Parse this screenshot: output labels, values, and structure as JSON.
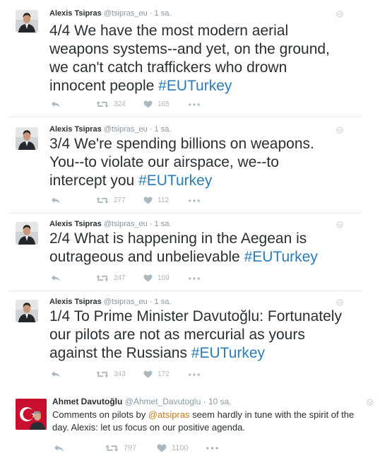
{
  "tweets": [
    {
      "name": "Alexis Tsipras",
      "handle": "@tsipras_eu",
      "time": "· 1 sa.",
      "text_main": "4/4 We have the most modern aerial weapons systems--and yet, on the ground, we can't catch traffickers who drown innocent people ",
      "hashtag": "#EUTurkey",
      "retweets": "324",
      "likes": "165"
    },
    {
      "name": "Alexis Tsipras",
      "handle": "@tsipras_eu",
      "time": "· 1 sa.",
      "text_main": "3/4 We're spending billions on weapons. You--to violate our airspace, we--to intercept you ",
      "hashtag": "#EUTurkey",
      "retweets": "277",
      "likes": "112"
    },
    {
      "name": "Alexis Tsipras",
      "handle": "@tsipras_eu",
      "time": "· 1 sa.",
      "text_main": "2/4 What is happening in the Aegean is outrageous and unbelievable ",
      "hashtag": "#EUTurkey",
      "retweets": "247",
      "likes": "109"
    },
    {
      "name": "Alexis Tsipras",
      "handle": "@tsipras_eu",
      "time": "· 1 sa.",
      "text_main": "1/4 To Prime Minister Davutoğlu: Fortunately our pilots are not as mercurial as yours against the Russians ",
      "hashtag": "#EUTurkey",
      "retweets": "343",
      "likes": "172"
    }
  ],
  "reply": {
    "name": "Ahmet Davutoğlu",
    "handle": "@Ahmet_Davutoglu",
    "time": "· 10 sa.",
    "text_before": "Comments on pilots by ",
    "mention": "@atsipras",
    "text_after": " seem hardly in tune with the spirit of the day. Alexis: let us focus on our positive agenda.",
    "retweets": "797",
    "likes": "1100"
  },
  "icons": {
    "reply": "reply-icon",
    "retweet": "retweet-icon",
    "like": "heart-icon",
    "more": "more-icon",
    "caret": "caret-down-icon"
  },
  "colors": {
    "hashtag": "#2b7bb9",
    "mention": "#c37e1a",
    "meta": "#8899a6",
    "action": "#aab8c2"
  }
}
